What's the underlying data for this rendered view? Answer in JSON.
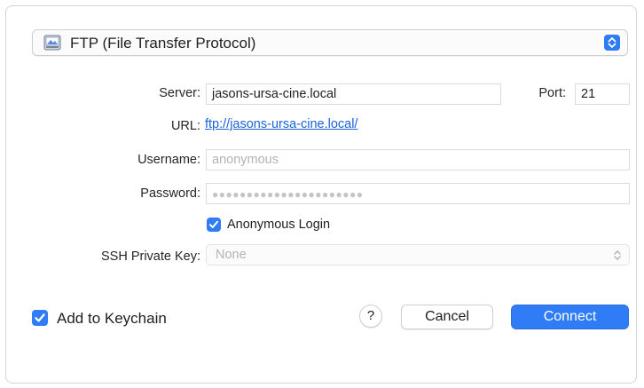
{
  "protocol": {
    "selected": "FTP (File Transfer Protocol)",
    "icon": "drive-icon"
  },
  "server": {
    "label": "Server:",
    "value": "jasons-ursa-cine.local"
  },
  "port": {
    "label": "Port:",
    "value": "21"
  },
  "url": {
    "label": "URL:",
    "link": "ftp://jasons-ursa-cine.local/"
  },
  "username": {
    "label": "Username:",
    "placeholder": "anonymous"
  },
  "password": {
    "label": "Password:",
    "masked": "●●●●●●●●●●●●●●●●●●●●●●"
  },
  "anonymous_login": {
    "label": "Anonymous Login",
    "checked": true
  },
  "ssh_key": {
    "label": "SSH Private Key:",
    "selected": "None"
  },
  "keychain": {
    "label": "Add to Keychain",
    "checked": true
  },
  "buttons": {
    "help": "?",
    "cancel": "Cancel",
    "connect": "Connect"
  },
  "colors": {
    "accent": "#2f7cf6",
    "link": "#1a63d6"
  }
}
